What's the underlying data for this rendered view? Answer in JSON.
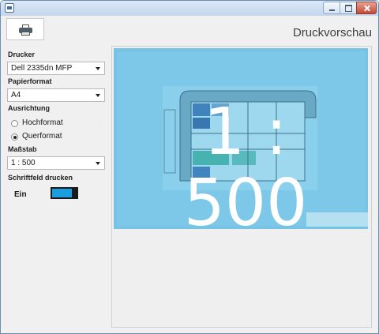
{
  "window": {
    "title": ""
  },
  "toolbar": {
    "print_icon": "printer-icon"
  },
  "page_title": "Druckvorschau",
  "settings": {
    "printer": {
      "label": "Drucker",
      "value": "Dell 2335dn MFP"
    },
    "paper": {
      "label": "Papierformat",
      "value": "A4"
    },
    "orientation": {
      "label": "Ausrichtung",
      "options": [
        {
          "label": "Hochformat",
          "selected": false
        },
        {
          "label": "Querformat",
          "selected": true
        }
      ]
    },
    "scale": {
      "label": "Maßstab",
      "value": "1 : 500"
    },
    "title_block": {
      "label": "Schriftfeld drucken",
      "toggle_label": "Ein",
      "on": true
    }
  },
  "preview": {
    "scale_overlay": "1 : 500"
  },
  "colors": {
    "accent": "#1b9ee0",
    "sheet": "#7dc8e8",
    "overlay_text": "#ffffff"
  }
}
